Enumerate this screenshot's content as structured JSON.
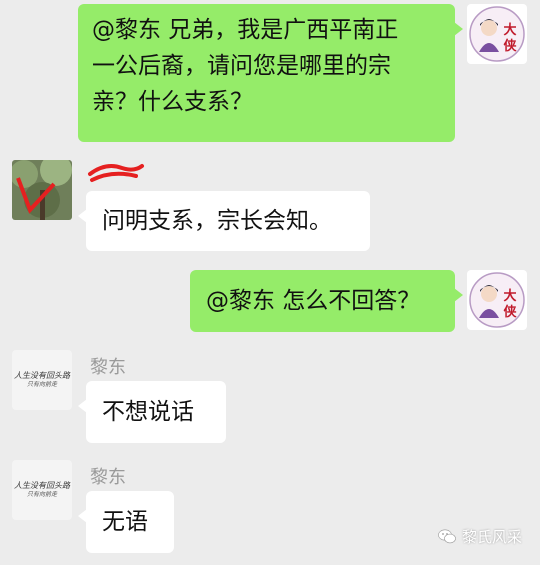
{
  "colors": {
    "background": "#ececec",
    "my_bubble": "#95ec69",
    "their_bubble": "#ffffff",
    "name_gray": "#9a9a9a"
  },
  "messages": [
    {
      "side": "right",
      "avatar": "daxia-avatar",
      "lines": [
        "@黎东 兄弟，我是广西平南正",
        "一公后裔，请问您是哪里的宗",
        "亲？什么支系？"
      ]
    },
    {
      "side": "left",
      "avatar": "tree-photo-avatar",
      "sender": "",
      "lines": [
        "问明支系，宗长会知。"
      ]
    },
    {
      "side": "right",
      "avatar": "daxia-avatar",
      "lines": [
        "@黎东 怎么不回答？"
      ]
    },
    {
      "side": "left",
      "avatar": "calligraphy-avatar",
      "sender": "黎东",
      "lines": [
        "不想说话"
      ]
    },
    {
      "side": "left",
      "avatar": "calligraphy-avatar",
      "sender": "黎东",
      "lines": [
        "无语"
      ]
    }
  ],
  "avatar_text": {
    "daxia": "大侠",
    "calligraphy_line1": "人生没有回头路",
    "calligraphy_line2": "只有向前走"
  },
  "watermark": {
    "icon": "wechat-icon",
    "text": "黎氏风采"
  }
}
